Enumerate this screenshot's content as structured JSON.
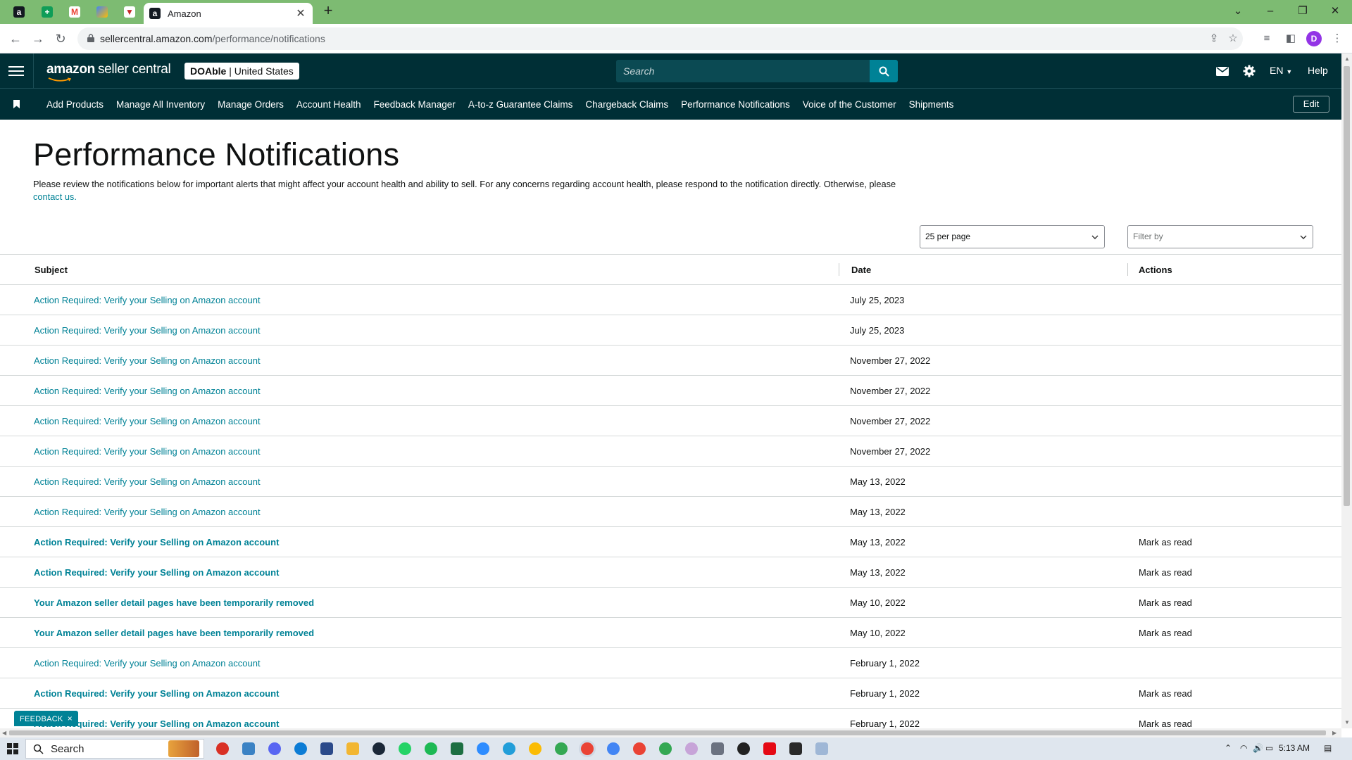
{
  "browser": {
    "tab_title": "Amazon",
    "url_domain": "sellercentral.amazon.com",
    "url_path": "/performance/notifications",
    "profile_initial": "D"
  },
  "header": {
    "logo_brand": "amazon",
    "logo_suffix": "seller central",
    "account_name": "DOAble",
    "account_region": "| United States",
    "search_placeholder": "Search",
    "language": "EN",
    "help": "Help"
  },
  "nav": {
    "items": [
      "Add Products",
      "Manage All Inventory",
      "Manage Orders",
      "Account Health",
      "Feedback Manager",
      "A-to-z Guarantee Claims",
      "Chargeback Claims",
      "Performance Notifications",
      "Voice of the Customer",
      "Shipments"
    ],
    "edit": "Edit"
  },
  "page": {
    "title": "Performance Notifications",
    "intro_text": "Please review the notifications below for important alerts that might affect your account health and ability to sell. For any concerns regarding account health, please respond to the notification directly. Otherwise, please ",
    "contact_link": "contact us.",
    "per_page": "25 per page",
    "filter_placeholder": "Filter by"
  },
  "table": {
    "columns": [
      "Subject",
      "Date",
      "Actions"
    ],
    "rows": [
      {
        "subject": "Action Required: Verify your Selling on Amazon account",
        "date": "July 25, 2023",
        "action": "",
        "unread": false
      },
      {
        "subject": "Action Required: Verify your Selling on Amazon account",
        "date": "July 25, 2023",
        "action": "",
        "unread": false
      },
      {
        "subject": "Action Required: Verify your Selling on Amazon account",
        "date": "November 27, 2022",
        "action": "",
        "unread": false
      },
      {
        "subject": "Action Required: Verify your Selling on Amazon account",
        "date": "November 27, 2022",
        "action": "",
        "unread": false
      },
      {
        "subject": "Action Required: Verify your Selling on Amazon account",
        "date": "November 27, 2022",
        "action": "",
        "unread": false
      },
      {
        "subject": "Action Required: Verify your Selling on Amazon account",
        "date": "November 27, 2022",
        "action": "",
        "unread": false
      },
      {
        "subject": "Action Required: Verify your Selling on Amazon account",
        "date": "May 13, 2022",
        "action": "",
        "unread": false
      },
      {
        "subject": "Action Required: Verify your Selling on Amazon account",
        "date": "May 13, 2022",
        "action": "",
        "unread": false
      },
      {
        "subject": "Action Required: Verify your Selling on Amazon account",
        "date": "May 13, 2022",
        "action": "Mark as read",
        "unread": true
      },
      {
        "subject": "Action Required: Verify your Selling on Amazon account",
        "date": "May 13, 2022",
        "action": "Mark as read",
        "unread": true
      },
      {
        "subject": "Your Amazon seller detail pages have been temporarily removed",
        "date": "May 10, 2022",
        "action": "Mark as read",
        "unread": true
      },
      {
        "subject": "Your Amazon seller detail pages have been temporarily removed",
        "date": "May 10, 2022",
        "action": "Mark as read",
        "unread": true
      },
      {
        "subject": "Action Required: Verify your Selling on Amazon account",
        "date": "February 1, 2022",
        "action": "",
        "unread": false
      },
      {
        "subject": "Action Required: Verify your Selling on Amazon account",
        "date": "February 1, 2022",
        "action": "Mark as read",
        "unread": true
      },
      {
        "subject": "Action Required: Verify your Selling on Amazon account",
        "date": "February 1, 2022",
        "action": "Mark as read",
        "unread": true
      }
    ]
  },
  "feedback": {
    "label": "FEEDBACK",
    "close": "×"
  },
  "taskbar": {
    "search_label": "Search",
    "time": "5:13 AM"
  },
  "colors": {
    "header_bg": "#002f36",
    "link": "#008296",
    "tabstrip": "#7dbb72"
  }
}
